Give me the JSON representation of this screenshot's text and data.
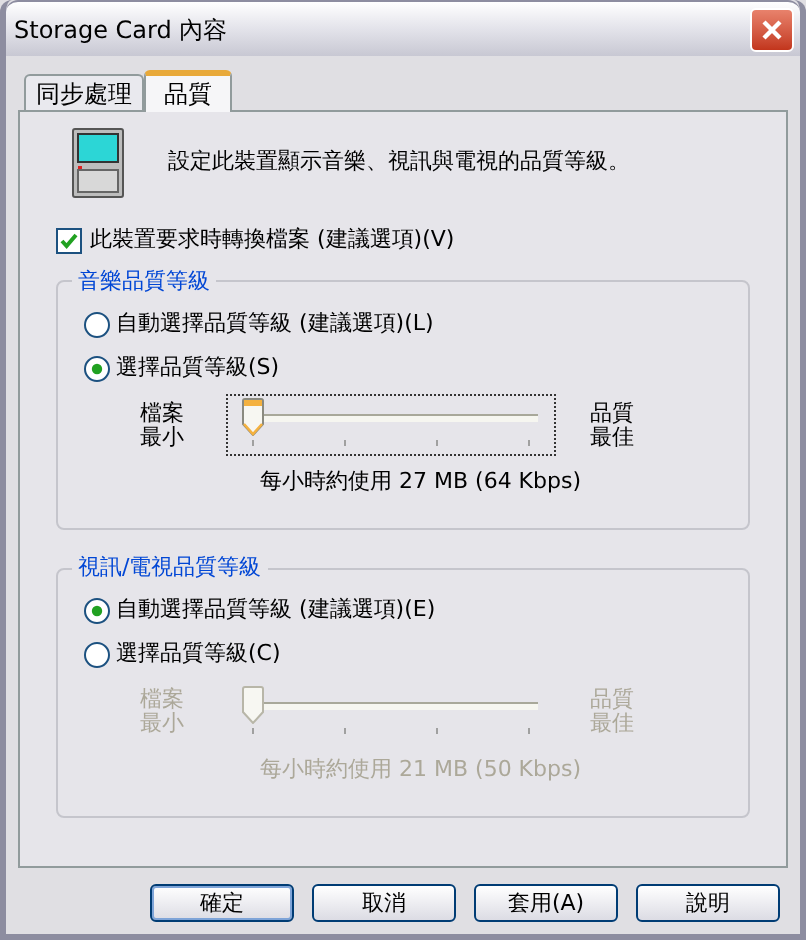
{
  "window": {
    "title": "Storage Card 內容"
  },
  "tabs": [
    {
      "label": "同步處理",
      "selected": false
    },
    {
      "label": "品質",
      "selected": true
    }
  ],
  "description": "設定此裝置顯示音樂、視訊與電視的品質等級。",
  "convert_checkbox": {
    "label": "此裝置要求時轉換檔案 (建議選項)(V)",
    "checked": true
  },
  "groups": [
    {
      "title": "音樂品質等級",
      "disabled": false,
      "options": [
        {
          "label": "自動選擇品質等級 (建議選項)(L)",
          "selected": false
        },
        {
          "label": "選擇品質等級(S)",
          "selected": true
        }
      ],
      "slider": {
        "min_label": "檔案最小",
        "max_label": "品質最佳",
        "level": 0,
        "focused": true,
        "reading": "每小時約使用 27 MB (64 Kbps)"
      }
    },
    {
      "title": "視訊/電視品質等級",
      "disabled": true,
      "options": [
        {
          "label": "自動選擇品質等級 (建議選項)(E)",
          "selected": true
        },
        {
          "label": "選擇品質等級(C)",
          "selected": false
        }
      ],
      "slider": {
        "min_label": "檔案最小",
        "max_label": "品質最佳",
        "level": 0,
        "focused": false,
        "reading": "每小時約使用 21 MB (50 Kbps)"
      }
    }
  ],
  "buttons": [
    {
      "label": "確定",
      "default": true
    },
    {
      "label": "取消",
      "default": false
    },
    {
      "label": "套用(A)",
      "default": false
    },
    {
      "label": "說明",
      "default": false
    }
  ]
}
